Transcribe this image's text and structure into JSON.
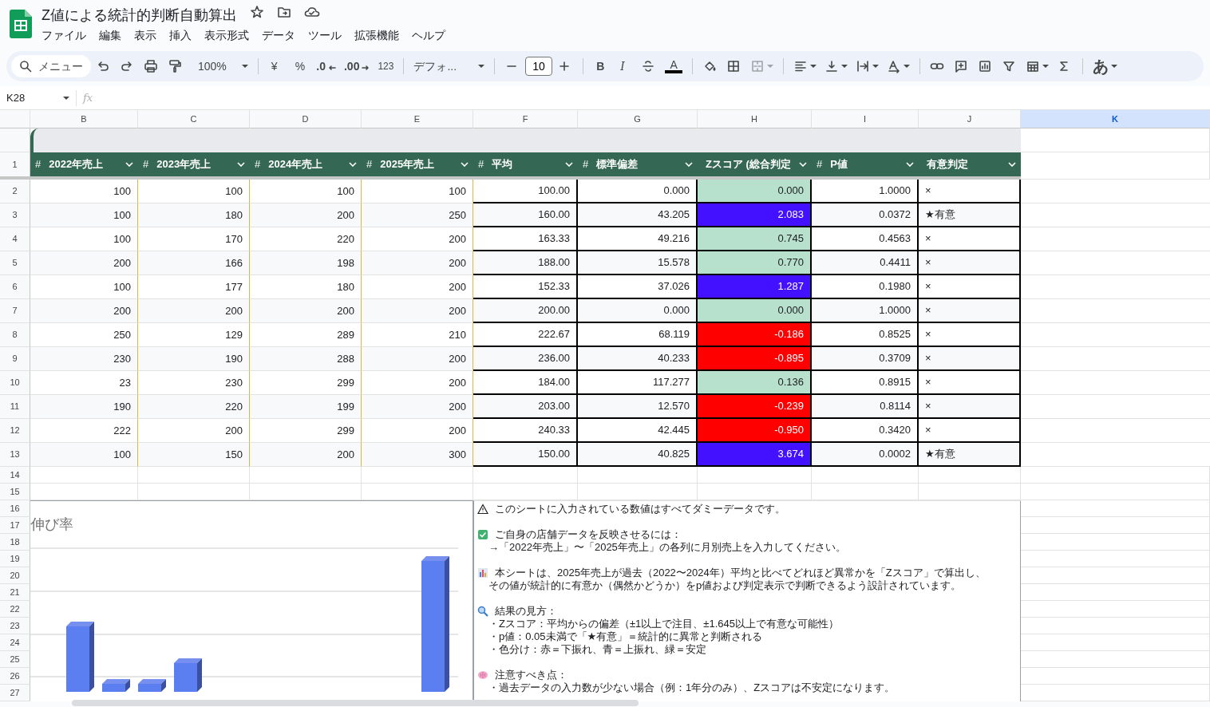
{
  "title": "Z値による統計的判断自動算出",
  "menus": [
    "ファイル",
    "編集",
    "表示",
    "挿入",
    "表示形式",
    "データ",
    "ツール",
    "拡張機能",
    "ヘルプ"
  ],
  "toolbar": {
    "search": "メニュー",
    "zoom": "100%",
    "currency": "¥",
    "percent": "%",
    "decrease_decimals": ".0",
    "increase_decimals": ".00",
    "number_format": "123",
    "font": "デフォ...",
    "font_size": "10",
    "bold": "B",
    "italic": "I",
    "text_color": "A",
    "input_tools": "あ"
  },
  "name_box": "K28",
  "formula_icon": "fx",
  "columns": [
    {
      "letter": "B",
      "selected": false
    },
    {
      "letter": "C",
      "selected": false
    },
    {
      "letter": "D",
      "selected": false
    },
    {
      "letter": "E",
      "selected": false
    },
    {
      "letter": "F",
      "selected": false
    },
    {
      "letter": "G",
      "selected": false
    },
    {
      "letter": "H",
      "selected": false
    },
    {
      "letter": "I",
      "selected": false
    },
    {
      "letter": "J",
      "selected": false
    },
    {
      "letter": "K",
      "selected": true
    }
  ],
  "header_row": {
    "number": "1",
    "cells": [
      {
        "prefix": "#",
        "label": "2022年売上"
      },
      {
        "prefix": "#",
        "label": "2023年売上"
      },
      {
        "prefix": "#",
        "label": "2024年売上"
      },
      {
        "prefix": "#",
        "label": "2025年売上"
      },
      {
        "prefix": "#",
        "label": "平均"
      },
      {
        "prefix": "#",
        "label": "標準偏差"
      },
      {
        "label": "Zスコア (総合判定"
      },
      {
        "prefix": "#",
        "label": "P値"
      },
      {
        "label": "有意判定"
      }
    ]
  },
  "rows": [
    {
      "number": "2",
      "values": [
        "100",
        "100",
        "100",
        "100",
        "100.00",
        "0.000"
      ],
      "z": {
        "text": "0.000",
        "color": "#b7e1cd"
      },
      "p": "1.0000",
      "judgement": "×"
    },
    {
      "number": "3",
      "values": [
        "100",
        "180",
        "200",
        "250",
        "160.00",
        "43.205"
      ],
      "z": {
        "text": "2.083",
        "color": "#4311ff"
      },
      "p": "0.0372",
      "judgement": "★有意"
    },
    {
      "number": "4",
      "values": [
        "100",
        "170",
        "220",
        "200",
        "163.33",
        "49.216"
      ],
      "z": {
        "text": "0.745",
        "color": "#b7e1cd"
      },
      "p": "0.4563",
      "judgement": "×"
    },
    {
      "number": "5",
      "values": [
        "200",
        "166",
        "198",
        "200",
        "188.00",
        "15.578"
      ],
      "z": {
        "text": "0.770",
        "color": "#b7e1cd"
      },
      "p": "0.4411",
      "judgement": "×"
    },
    {
      "number": "6",
      "values": [
        "100",
        "177",
        "180",
        "200",
        "152.33",
        "37.026"
      ],
      "z": {
        "text": "1.287",
        "color": "#4311ff"
      },
      "p": "0.1980",
      "judgement": "×"
    },
    {
      "number": "7",
      "values": [
        "200",
        "200",
        "200",
        "200",
        "200.00",
        "0.000"
      ],
      "z": {
        "text": "0.000",
        "color": "#b7e1cd"
      },
      "p": "1.0000",
      "judgement": "×"
    },
    {
      "number": "8",
      "values": [
        "250",
        "129",
        "289",
        "210",
        "222.67",
        "68.119"
      ],
      "z": {
        "text": "-0.186",
        "color": "#ff0000"
      },
      "p": "0.8525",
      "judgement": "×"
    },
    {
      "number": "9",
      "values": [
        "230",
        "190",
        "288",
        "200",
        "236.00",
        "40.233"
      ],
      "z": {
        "text": "-0.895",
        "color": "#ff0000"
      },
      "p": "0.3709",
      "judgement": "×"
    },
    {
      "number": "10",
      "values": [
        "23",
        "230",
        "299",
        "200",
        "184.00",
        "117.277"
      ],
      "z": {
        "text": "0.136",
        "color": "#b7e1cd"
      },
      "p": "0.8915",
      "judgement": "×"
    },
    {
      "number": "11",
      "values": [
        "190",
        "220",
        "199",
        "200",
        "203.00",
        "12.570"
      ],
      "z": {
        "text": "-0.239",
        "color": "#ff0000"
      },
      "p": "0.8114",
      "judgement": "×"
    },
    {
      "number": "12",
      "values": [
        "222",
        "200",
        "299",
        "200",
        "240.33",
        "42.445"
      ],
      "z": {
        "text": "-0.950",
        "color": "#ff0000"
      },
      "p": "0.3420",
      "judgement": "×"
    },
    {
      "number": "13",
      "values": [
        "100",
        "150",
        "200",
        "300",
        "150.00",
        "40.825"
      ],
      "z": {
        "text": "3.674",
        "color": "#4311ff"
      },
      "p": "0.0002",
      "judgement": "★有意"
    }
  ],
  "lower_row_numbers": [
    "14",
    "15",
    "16",
    "17",
    "18",
    "19",
    "20",
    "21",
    "22",
    "23",
    "24",
    "25",
    "26",
    "27"
  ],
  "chart": {
    "title": "伸び率",
    "kind": "picture"
  },
  "notes": [
    {
      "kind": "warning",
      "heading": "このシートに入力されている数値はすべてダミーデータです。"
    },
    {
      "kind": "check",
      "heading": "ご自身の店舗データを反映させるには：",
      "lines": [
        "→「2022年売上」〜「2025年売上」の各列に月別売上を入力してください。"
      ]
    },
    {
      "kind": "chart",
      "heading": "本シートは、2025年売上が過去（2022〜2024年）平均と比べてどれほど異常かを「Zスコア」で算出し、",
      "lines": [
        "その値が統計的に有意か（偶然かどうか）をp値および判定表示で判断できるよう設計されています。"
      ]
    },
    {
      "kind": "search",
      "heading": "結果の見方：",
      "lines": [
        "・Zスコア：平均からの偏差（±1以上で注目、±1.645以上で有意な可能性）",
        "・p値：0.05未満で「★有意」＝統計的に異常と判断される",
        "・色分け：赤＝下振れ、青＝上振れ、緑＝安定"
      ]
    },
    {
      "kind": "brain",
      "heading": "注意すべき点：",
      "lines": [
        "・過去データの入力数が少ない場合（例：1年分のみ）、Zスコアは不安定になります。"
      ]
    }
  ]
}
